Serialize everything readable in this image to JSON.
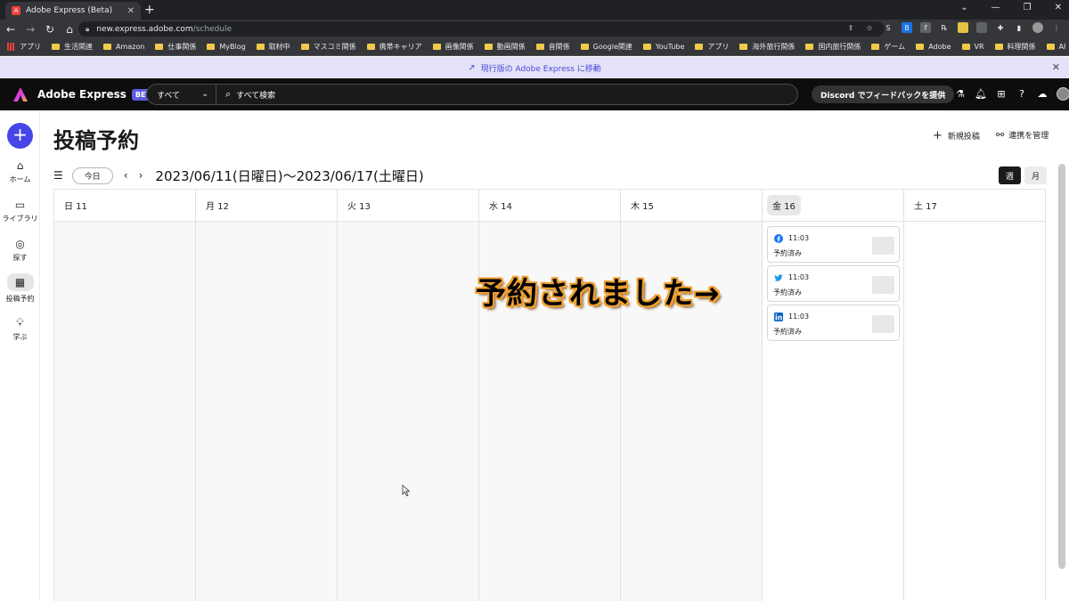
{
  "browser": {
    "tab_title": "Adobe Express (Beta)",
    "url_host": "new.express.adobe.com",
    "url_path": "/schedule",
    "bookmarks": [
      "アプリ",
      "生活関連",
      "Amazon",
      "仕事関係",
      "MyBlog",
      "取材中",
      "マスコミ関係",
      "携帯キャリア",
      "画像関係",
      "動画関係",
      "音関係",
      "Google関連",
      "YouTube",
      "アプリ",
      "海外旅行関係",
      "国内旅行関係",
      "ゲーム",
      "Adobe",
      "VR",
      "料理関係",
      "AI"
    ]
  },
  "banner": {
    "text": "現行版の Adobe Express に移動"
  },
  "header": {
    "brand": "Adobe Express",
    "beta": "BETA 版",
    "scope": "すべて",
    "search_placeholder": "すべて検索",
    "discord": "Discord でフィードバックを提供"
  },
  "rail": {
    "items": [
      {
        "label": "ホーム",
        "icon": "home-icon"
      },
      {
        "label": "ライブラリ",
        "icon": "folder-icon"
      },
      {
        "label": "探す",
        "icon": "compass-icon"
      },
      {
        "label": "投稿予約",
        "icon": "calendar-icon"
      },
      {
        "label": "学ぶ",
        "icon": "lightbulb-icon"
      }
    ]
  },
  "page": {
    "title": "投稿予約",
    "new_post": "新規投稿",
    "manage": "連携を管理",
    "today": "今日",
    "date_range": "2023/06/11(日曜日)〜2023/06/17(土曜日)",
    "view_week": "週",
    "view_month": "月"
  },
  "calendar": {
    "days": [
      "日 11",
      "月 12",
      "火 13",
      "水 14",
      "木 15",
      "金 16",
      "土 17"
    ],
    "posts": [
      {
        "network": "facebook",
        "time": "11:03",
        "status": "予約済み"
      },
      {
        "network": "twitter",
        "time": "11:03",
        "status": "予約済み"
      },
      {
        "network": "linkedin",
        "time": "11:03",
        "status": "予約済み"
      }
    ]
  },
  "annotation": {
    "text": "予約されました→"
  },
  "colors": {
    "accent": "#4646e6",
    "facebook": "#1877f2",
    "twitter": "#1d9bf0",
    "linkedin": "#0a66c2",
    "annotation_outline": "#f0a030"
  }
}
